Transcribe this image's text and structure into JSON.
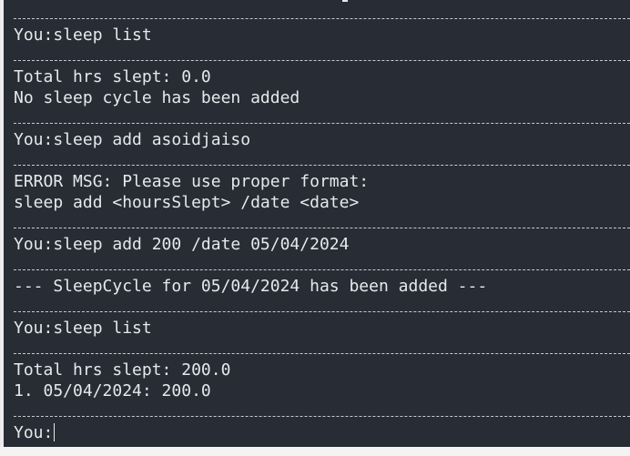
{
  "terminal": {
    "lines": [
      "You:sleep list",
      "Total hrs slept: 0.0",
      "No sleep cycle has been added",
      "You:sleep add asoidjaiso",
      "ERROR MSG: Please use proper format:",
      "sleep add <hoursSlept> /date <date>",
      "You:sleep add 200 /date 05/04/2024",
      "--- SleepCycle for 05/04/2024 has been added ---",
      "You:sleep list",
      "Total hrs slept: 200.0",
      "1. 05/04/2024: 200.0",
      "You:"
    ]
  },
  "colors": {
    "background": "#282c34",
    "text": "#e6e8ec",
    "separator": "#c6cad2"
  }
}
